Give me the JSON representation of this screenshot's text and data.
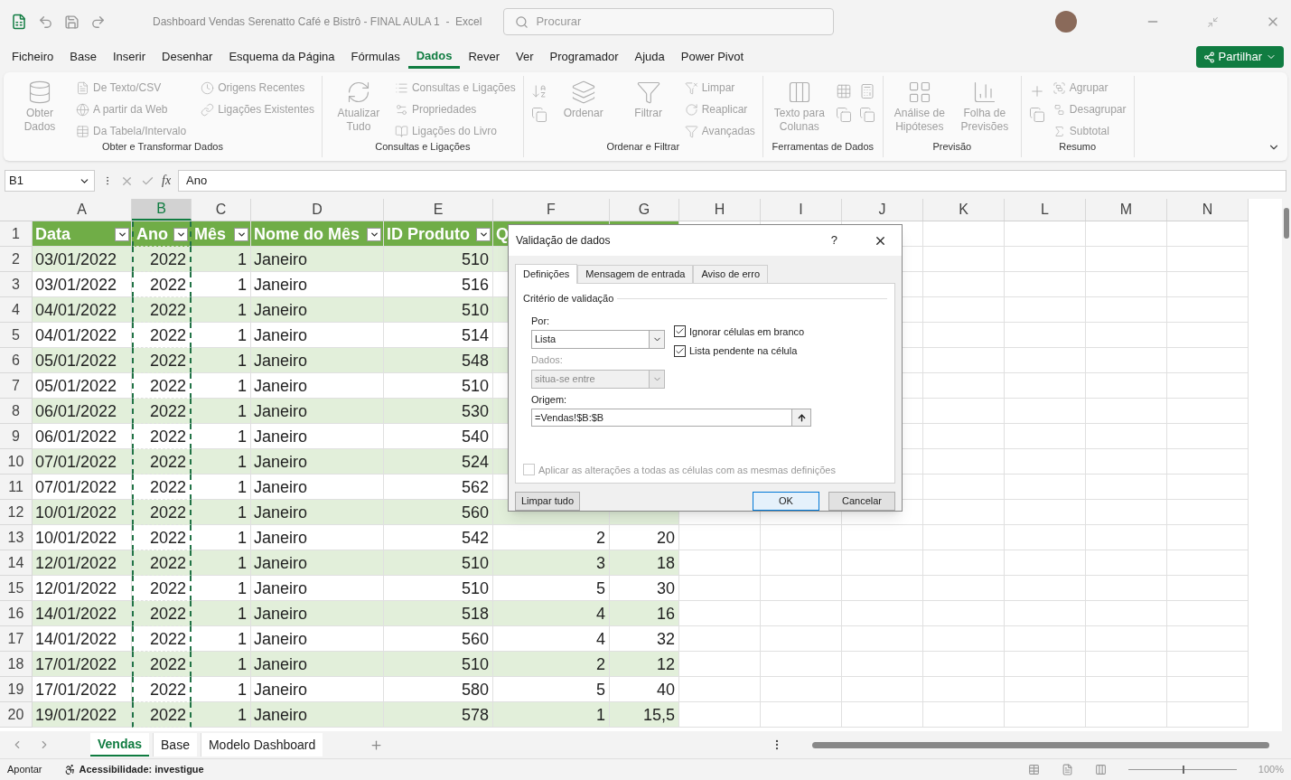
{
  "titlebar": {
    "title": "Dashboard Vendas Serenatto Café e Bistrô - FINAL AULA 1  -  Excel",
    "search_placeholder": "Procurar"
  },
  "menu_tabs": [
    {
      "label": "Ficheiro",
      "selected": false
    },
    {
      "label": "Base",
      "selected": false
    },
    {
      "label": "Inserir",
      "selected": false
    },
    {
      "label": "Desenhar",
      "selected": false
    },
    {
      "label": "Esquema da Página",
      "selected": false
    },
    {
      "label": "Fórmulas",
      "selected": false
    },
    {
      "label": "Dados",
      "selected": true
    },
    {
      "label": "Rever",
      "selected": false
    },
    {
      "label": "Ver",
      "selected": false
    },
    {
      "label": "Programador",
      "selected": false
    },
    {
      "label": "Ajuda",
      "selected": false
    },
    {
      "label": "Power Pivot",
      "selected": false
    }
  ],
  "share_button": "Partilhar",
  "ribbon_groups": [
    {
      "label": "Obter e Transformar Dados",
      "items": [
        {
          "kind": "large",
          "label": "Obter Dados"
        },
        {
          "kind": "small",
          "label": "De Texto/CSV"
        },
        {
          "kind": "small",
          "label": "A partir da Web"
        },
        {
          "kind": "small",
          "label": "Da Tabela/Intervalo"
        },
        {
          "kind": "small",
          "label": "Origens Recentes"
        },
        {
          "kind": "small",
          "label": "Ligações Existentes"
        }
      ]
    },
    {
      "label": "Consultas e Ligações",
      "items": [
        {
          "kind": "large",
          "label": "Atualizar Tudo"
        },
        {
          "kind": "small",
          "label": "Consultas e Ligações"
        },
        {
          "kind": "small",
          "label": "Propriedades"
        },
        {
          "kind": "small",
          "label": "Ligações do Livro"
        }
      ]
    },
    {
      "label": "Ordenar e Filtrar",
      "items": [
        {
          "kind": "icon"
        },
        {
          "kind": "large",
          "label": "Ordenar"
        },
        {
          "kind": "large",
          "label": "Filtrar"
        },
        {
          "kind": "small",
          "label": "Limpar"
        },
        {
          "kind": "small",
          "label": "Reaplicar"
        },
        {
          "kind": "small",
          "label": "Avançadas"
        }
      ]
    },
    {
      "label": "Ferramentas de Dados",
      "items": [
        {
          "kind": "large",
          "label": "Texto para Colunas"
        },
        {
          "kind": "icon"
        },
        {
          "kind": "icon"
        }
      ]
    },
    {
      "label": "Previsão",
      "items": [
        {
          "kind": "large",
          "label": "Análise de Hipóteses"
        },
        {
          "kind": "large",
          "label": "Folha de Previsões"
        }
      ]
    },
    {
      "label": "Resumo",
      "items": [
        {
          "kind": "small",
          "label": "Agrupar"
        },
        {
          "kind": "small",
          "label": "Desagrupar"
        },
        {
          "kind": "small",
          "label": "Subtotal"
        },
        {
          "kind": "icon"
        }
      ]
    }
  ],
  "formula_bar": {
    "name_box": "B1",
    "fx_label": "fx",
    "formula": "Ano"
  },
  "columns": [
    {
      "letter": "A",
      "selected": false,
      "marquee": false
    },
    {
      "letter": "B",
      "selected": true,
      "marquee": true
    },
    {
      "letter": "C",
      "selected": false,
      "marquee": false
    },
    {
      "letter": "D",
      "selected": false,
      "marquee": false
    },
    {
      "letter": "E",
      "selected": false,
      "marquee": false
    },
    {
      "letter": "F",
      "selected": false,
      "marquee": false
    },
    {
      "letter": "G",
      "selected": false,
      "marquee": false
    },
    {
      "letter": "H",
      "selected": false,
      "marquee": false
    },
    {
      "letter": "I",
      "selected": false,
      "marquee": false
    },
    {
      "letter": "J",
      "selected": false,
      "marquee": false
    },
    {
      "letter": "K",
      "selected": false,
      "marquee": false
    },
    {
      "letter": "L",
      "selected": false,
      "marquee": false
    },
    {
      "letter": "M",
      "selected": false,
      "marquee": false
    },
    {
      "letter": "N",
      "selected": false,
      "marquee": false
    }
  ],
  "header_row": {
    "number": "1",
    "cells": [
      "Data",
      "Ano",
      "Mês",
      "Nome do Mês",
      "ID Produto",
      "Q"
    ]
  },
  "rows": [
    {
      "number": "2",
      "cells": [
        "03/01/2022",
        "2022",
        "1",
        "Janeiro",
        "510"
      ]
    },
    {
      "number": "3",
      "cells": [
        "03/01/2022",
        "2022",
        "1",
        "Janeiro",
        "516"
      ]
    },
    {
      "number": "4",
      "cells": [
        "04/01/2022",
        "2022",
        "1",
        "Janeiro",
        "510"
      ]
    },
    {
      "number": "5",
      "cells": [
        "04/01/2022",
        "2022",
        "1",
        "Janeiro",
        "514"
      ]
    },
    {
      "number": "6",
      "cells": [
        "05/01/2022",
        "2022",
        "1",
        "Janeiro",
        "548"
      ]
    },
    {
      "number": "7",
      "cells": [
        "05/01/2022",
        "2022",
        "1",
        "Janeiro",
        "510"
      ]
    },
    {
      "number": "8",
      "cells": [
        "06/01/2022",
        "2022",
        "1",
        "Janeiro",
        "530"
      ]
    },
    {
      "number": "9",
      "cells": [
        "06/01/2022",
        "2022",
        "1",
        "Janeiro",
        "540"
      ]
    },
    {
      "number": "10",
      "cells": [
        "07/01/2022",
        "2022",
        "1",
        "Janeiro",
        "524"
      ]
    },
    {
      "number": "11",
      "cells": [
        "07/01/2022",
        "2022",
        "1",
        "Janeiro",
        "562"
      ]
    },
    {
      "number": "12",
      "cells": [
        "10/01/2022",
        "2022",
        "1",
        "Janeiro",
        "560"
      ]
    },
    {
      "number": "13",
      "cells": [
        "10/01/2022",
        "2022",
        "1",
        "Janeiro",
        "542",
        "2",
        "20"
      ]
    },
    {
      "number": "14",
      "cells": [
        "12/01/2022",
        "2022",
        "1",
        "Janeiro",
        "510",
        "3",
        "18"
      ]
    },
    {
      "number": "15",
      "cells": [
        "12/01/2022",
        "2022",
        "1",
        "Janeiro",
        "510",
        "5",
        "30"
      ]
    },
    {
      "number": "16",
      "cells": [
        "14/01/2022",
        "2022",
        "1",
        "Janeiro",
        "518",
        "4",
        "16"
      ]
    },
    {
      "number": "17",
      "cells": [
        "14/01/2022",
        "2022",
        "1",
        "Janeiro",
        "560",
        "4",
        "32"
      ]
    },
    {
      "number": "18",
      "cells": [
        "17/01/2022",
        "2022",
        "1",
        "Janeiro",
        "510",
        "2",
        "12"
      ]
    },
    {
      "number": "19",
      "cells": [
        "17/01/2022",
        "2022",
        "1",
        "Janeiro",
        "580",
        "5",
        "40"
      ]
    },
    {
      "number": "20",
      "cells": [
        "19/01/2022",
        "2022",
        "1",
        "Janeiro",
        "578",
        "1",
        "15,5"
      ]
    }
  ],
  "dialog": {
    "title": "Validação de dados",
    "help": "?",
    "tabs": [
      {
        "label": "Definições",
        "selected": true
      },
      {
        "label": "Mensagem de entrada",
        "selected": false
      },
      {
        "label": "Aviso de erro",
        "selected": false
      }
    ],
    "section": "Critério de validação",
    "allow_label": "Por:",
    "allow_value": "Lista",
    "data_label": "Dados:",
    "data_value": "situa-se entre",
    "data_disabled": true,
    "checkboxes": [
      {
        "label": "Ignorar células em branco",
        "checked": true
      },
      {
        "label": "Lista pendente na célula",
        "checked": true
      }
    ],
    "source_label": "Origem:",
    "source_value": "=Vendas!$B:$B",
    "apply_all": {
      "label": "Aplicar as alterações a todas as células com as mesmas definições",
      "checked": false,
      "disabled": true
    },
    "buttons": [
      {
        "label": "Limpar tudo",
        "kind": "secondary"
      },
      {
        "label": "OK",
        "kind": "default"
      },
      {
        "label": "Cancelar",
        "kind": "secondary"
      }
    ]
  },
  "sheet_tabs": [
    {
      "label": "Vendas",
      "selected": true
    },
    {
      "label": "Base",
      "selected": false
    },
    {
      "label": "Modelo Dashboard",
      "selected": false
    }
  ],
  "status_bar": {
    "mode": "Apontar",
    "accessibility": "Acessibilidade: investigue",
    "zoom": "100%",
    "zoom_slider": {
      "level": 0.5
    }
  }
}
